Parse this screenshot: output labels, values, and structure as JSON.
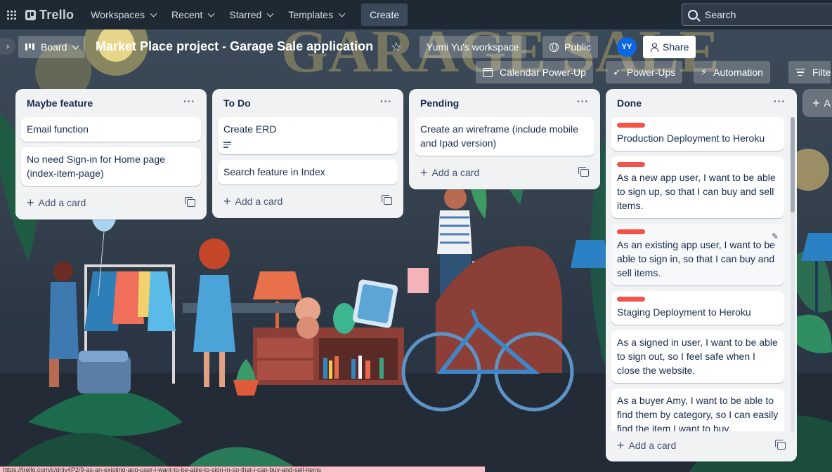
{
  "topnav": {
    "logo": "Trello",
    "menus": [
      "Workspaces",
      "Recent",
      "Starred",
      "Templates"
    ],
    "create": "Create",
    "search_placeholder": "Search"
  },
  "board_header": {
    "view": "Board",
    "title": "Market Place project - Garage Sale application",
    "workspace": "Yumi Yu's workspace",
    "visibility": "Public",
    "avatar_initials": "YY",
    "share": "Share",
    "calendar": "Calendar Power-Up",
    "power_ups": "Power-Ups",
    "automation": "Automation",
    "filter": "Filte"
  },
  "background_sign": "GARAGE SALE",
  "lists": [
    {
      "title": "Maybe feature",
      "cards": [
        {
          "text": "Email function"
        },
        {
          "text": "No need Sign-in for Home page (index-item-page)"
        }
      ]
    },
    {
      "title": "To Do",
      "cards": [
        {
          "text": "Create ERD",
          "has_description": true
        },
        {
          "text": "Search feature in Index"
        }
      ]
    },
    {
      "title": "Pending",
      "cards": [
        {
          "text": "Create an wireframe (include mobile and Ipad version)"
        }
      ]
    },
    {
      "title": "Done",
      "cards": [
        {
          "text": "Production Deployment to Heroku",
          "label_color": "#f2544a"
        },
        {
          "text": "As a new app user, I want to be able to sign up, so that I can buy and sell items.",
          "label_color": "#f2544a"
        },
        {
          "text": "As an existing app user, I want to be able to sign in, so that I can buy and sell items.",
          "label_color": "#f2544a"
        },
        {
          "text": "Staging Deployment to Heroku",
          "label_color": "#f2544a"
        },
        {
          "text": "As a signed in user, I want to be able to sign out, so I feel safe when I close the website."
        },
        {
          "text": "As a buyer Amy, I want to be able to find them by category, so I can easily find the item I want to buy."
        }
      ]
    }
  ],
  "add_card_label": "Add a card",
  "add_list_label": "A",
  "status_url": "https://trello.com/c/dnjv4P2/9-as-an-existing-app-user-i-want-to-be-able-to-sign-in-so-that-i-can-buy-and-sell-items"
}
